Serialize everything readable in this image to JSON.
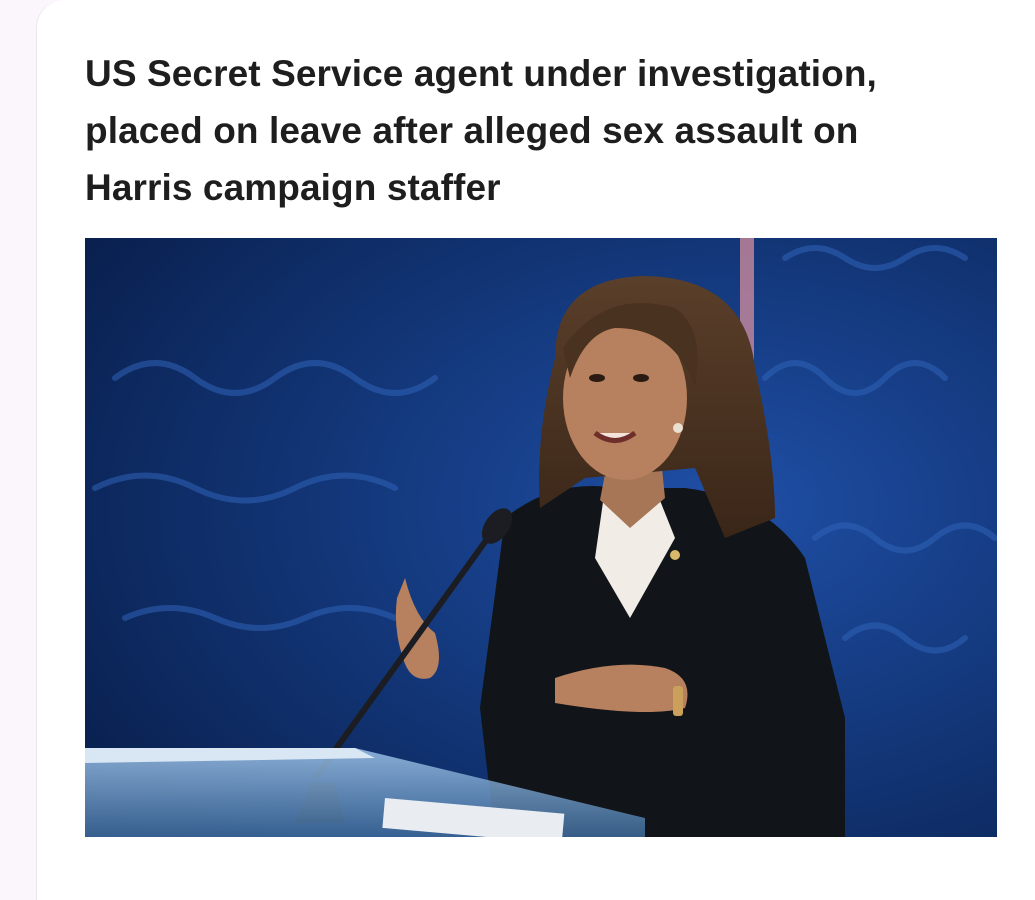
{
  "article": {
    "headline": "US Secret Service agent under investigation, placed on leave after alleged sex assault on Harris campaign staffer",
    "image_description_icon": "news-photo"
  },
  "colors": {
    "page_background": "#fbf6fb",
    "card_background": "#ffffff",
    "headline_text": "#1e1e1e",
    "photo_backdrop": "#0d2a63"
  }
}
